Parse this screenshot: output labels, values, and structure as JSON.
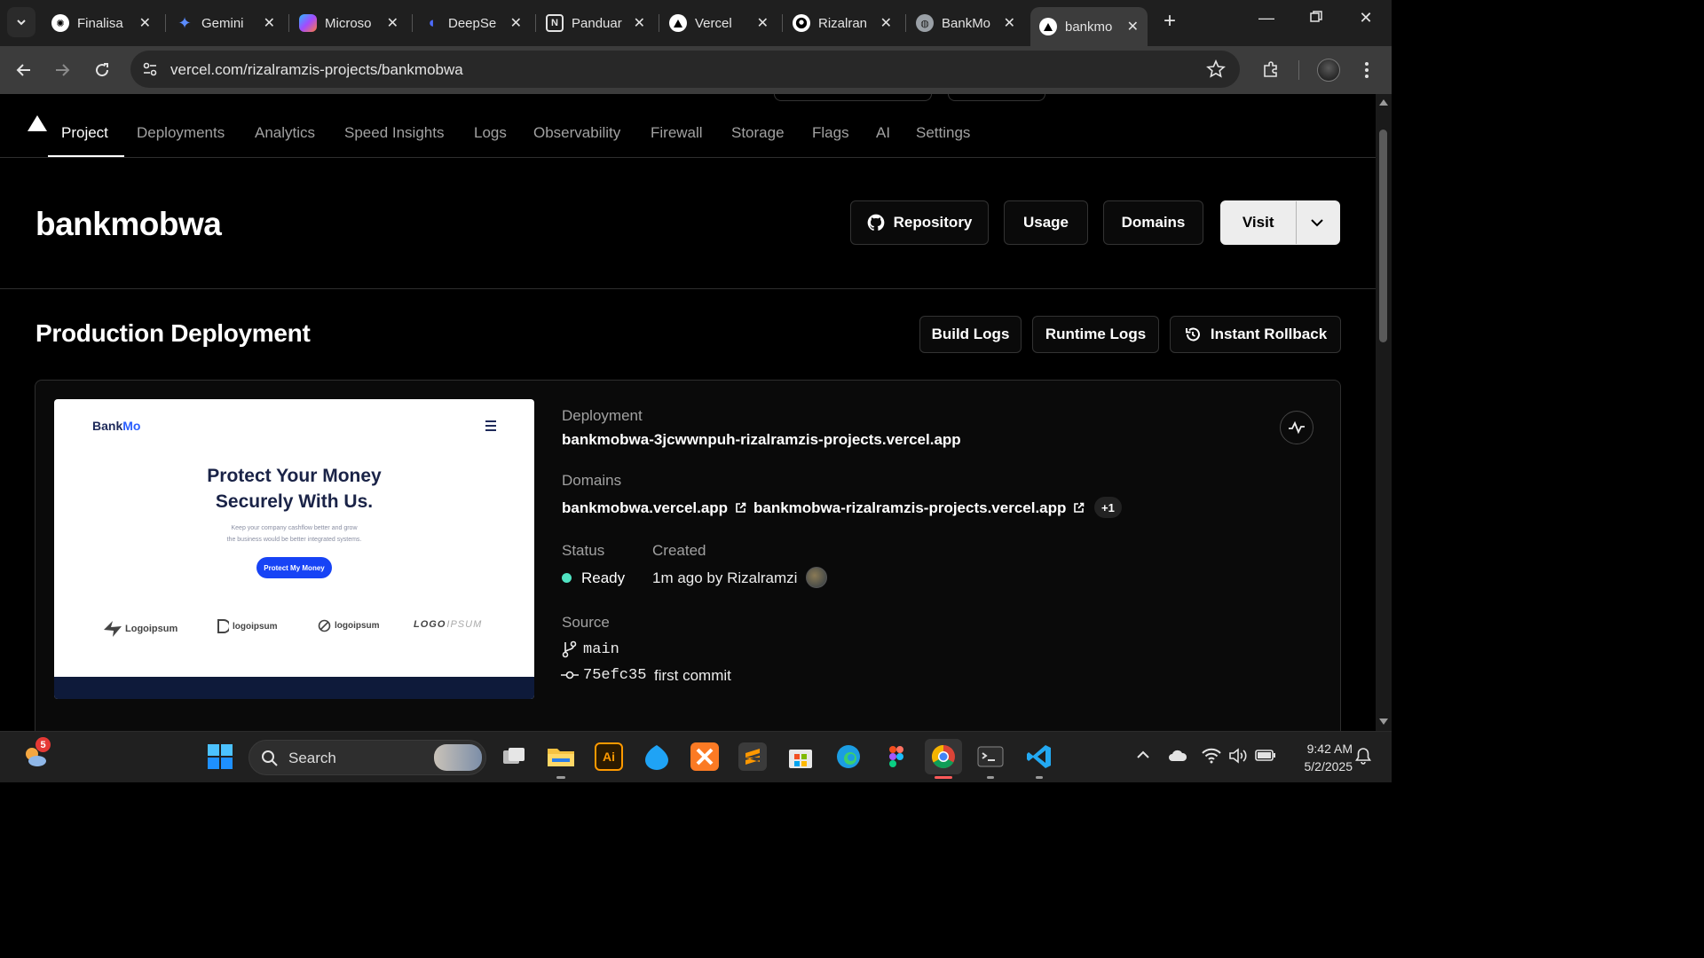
{
  "browser": {
    "tabs": [
      {
        "label": "Finalisa",
        "icon": "openai-icon"
      },
      {
        "label": "Gemini",
        "icon": "gemini-icon"
      },
      {
        "label": "Microso",
        "icon": "copilot-icon"
      },
      {
        "label": "DeepSe",
        "icon": "deepseek-icon"
      },
      {
        "label": "Panduar",
        "icon": "notion-icon"
      },
      {
        "label": "Vercel",
        "icon": "vercel-icon"
      },
      {
        "label": "Rizalran",
        "icon": "github-icon"
      },
      {
        "label": "BankMo",
        "icon": "globe-icon"
      },
      {
        "label": "bankmo",
        "icon": "vercel-icon",
        "active": true
      }
    ],
    "url": "vercel.com/rizalramzis-projects/bankmobwa"
  },
  "project_nav": {
    "items": [
      "Project",
      "Deployments",
      "Analytics",
      "Speed Insights",
      "Logs",
      "Observability",
      "Firewall",
      "Storage",
      "Flags",
      "AI",
      "Settings"
    ],
    "active": "Project"
  },
  "header": {
    "title": "bankmobwa",
    "repository": "Repository",
    "usage": "Usage",
    "domains": "Domains",
    "visit": "Visit"
  },
  "production": {
    "title": "Production Deployment",
    "build_logs": "Build Logs",
    "runtime_logs": "Runtime Logs",
    "instant_rollback": "Instant Rollback",
    "deployment_label": "Deployment",
    "deployment_url": "bankmobwa-3jcwwnpuh-rizalramzis-projects.vercel.app",
    "domains_label": "Domains",
    "domain_1": "bankmobwa.vercel.app",
    "domain_2": "bankmobwa-rizalramzis-projects.vercel.app",
    "domain_more": "+1",
    "status_label": "Status",
    "status_value": "Ready",
    "status_color": "#50e3c2",
    "created_label": "Created",
    "created_value": "1m ago by Rizalramzi",
    "source_label": "Source",
    "branch": "main",
    "commit_hash": "75efc35",
    "commit_message": "first commit"
  },
  "preview": {
    "brand_a": "Bank",
    "brand_b": "Mo",
    "headline_1": "Protect Your Money",
    "headline_2": "Securely With Us.",
    "sub_1": "Keep your company cashflow better and grow",
    "sub_2": "the business would be better integrated systems.",
    "cta": "Protect My Money",
    "logos": [
      "Logoipsum",
      "logoipsum",
      "logoipsum",
      "LOGO"
    ]
  },
  "taskbar": {
    "search": "Search",
    "notification_count": "5",
    "time": "9:42 AM",
    "date": "5/2/2025"
  }
}
